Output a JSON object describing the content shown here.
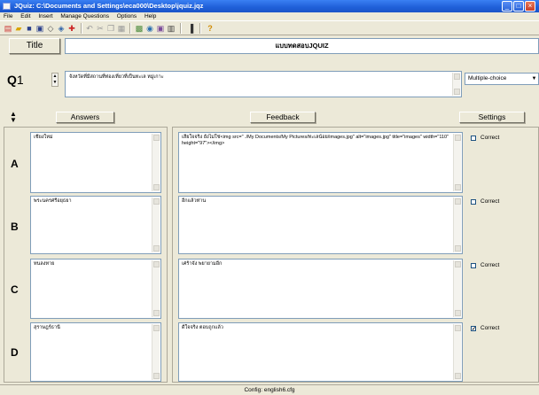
{
  "window": {
    "title": "JQuiz: C:\\Documents and Settings\\eca000\\Desktop\\jquiz.jqz"
  },
  "menu": [
    "File",
    "Edit",
    "Insert",
    "Manage Questions",
    "Options",
    "Help"
  ],
  "toolbar_icons": [
    "new-icon",
    "open-icon",
    "save-icon",
    "save-as-icon",
    "export-icon",
    "web-icon",
    "add-icon",
    "undo-icon",
    "cut-icon",
    "copy-icon",
    "paste-icon",
    "image-icon",
    "link-icon",
    "media-icon",
    "reading-icon",
    "config-icon",
    "help-icon"
  ],
  "title_row": {
    "label": "Title",
    "value": "แบบทดสอบJQUIZ"
  },
  "question": {
    "label": "Q",
    "number": "1",
    "text": "จังหวัดที่มีสถานที่ท่องเที่ยวที่เป็นทะเล หมู่เกาะ",
    "type": "Multiple-choice"
  },
  "headers": {
    "answers": "Answers",
    "feedback": "Feedback",
    "settings": "Settings"
  },
  "rows": [
    {
      "letter": "A",
      "answer": "เชียงใหม่",
      "feedback": "เสียใจจริง ยังไม่ใช่<img src=\" ./My Documents/My Pictures/ทะเลน้อย/images.jpg\" alt=\"images.jpg\" title=\"images\" width=\"110\" height=\"97\"></img>",
      "correct_label": "Correct",
      "checked": ""
    },
    {
      "letter": "B",
      "answer": "พระนครศรีอยุธยา",
      "feedback": "อีกแล้วท่าน",
      "correct_label": "Correct",
      "checked": ""
    },
    {
      "letter": "C",
      "answer": "ทนลงทาย",
      "feedback": "เศร้าจัง พยายามอีก",
      "correct_label": "Correct",
      "checked": ""
    },
    {
      "letter": "D",
      "answer": "สุราษฎร์ธานี",
      "feedback": "ดีใจจริง ตอบถูกแล้ว",
      "correct_label": "Correct",
      "checked": "✓"
    }
  ],
  "status": "Config: english6.cfg",
  "colors": {
    "titlebar": "#2462d8",
    "window_bg": "#ece9d8",
    "field_border": "#7f9db9"
  }
}
